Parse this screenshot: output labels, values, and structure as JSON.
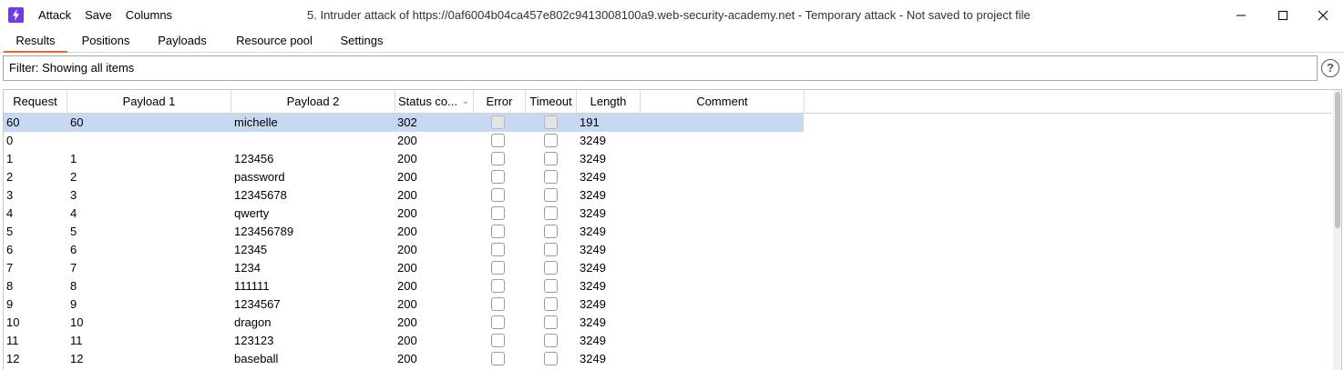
{
  "menu": [
    "Attack",
    "Save",
    "Columns"
  ],
  "window_title": "5. Intruder attack of https://0af6004b04ca457e802c9413008100a9.web-security-academy.net - Temporary attack - Not saved to project file",
  "tabs": [
    "Results",
    "Positions",
    "Payloads",
    "Resource pool",
    "Settings"
  ],
  "filter_text": "Filter: Showing all items",
  "help_label": "?",
  "columns": [
    "Request",
    "Payload 1",
    "Payload 2",
    "Status co...",
    "Error",
    "Timeout",
    "Length",
    "Comment"
  ],
  "colors": {
    "accent": "#e8672f",
    "selected_row": "#c7d9f2",
    "app_icon": "#6a3ee0"
  },
  "rows": [
    {
      "request": "60",
      "payload1": "60",
      "payload2": "michelle",
      "status": "302",
      "length": "191",
      "comment": "",
      "selected": true
    },
    {
      "request": "0",
      "payload1": "",
      "payload2": "",
      "status": "200",
      "length": "3249",
      "comment": ""
    },
    {
      "request": "1",
      "payload1": "1",
      "payload2": "123456",
      "status": "200",
      "length": "3249",
      "comment": ""
    },
    {
      "request": "2",
      "payload1": "2",
      "payload2": "password",
      "status": "200",
      "length": "3249",
      "comment": ""
    },
    {
      "request": "3",
      "payload1": "3",
      "payload2": "12345678",
      "status": "200",
      "length": "3249",
      "comment": ""
    },
    {
      "request": "4",
      "payload1": "4",
      "payload2": "qwerty",
      "status": "200",
      "length": "3249",
      "comment": ""
    },
    {
      "request": "5",
      "payload1": "5",
      "payload2": "123456789",
      "status": "200",
      "length": "3249",
      "comment": ""
    },
    {
      "request": "6",
      "payload1": "6",
      "payload2": "12345",
      "status": "200",
      "length": "3249",
      "comment": ""
    },
    {
      "request": "7",
      "payload1": "7",
      "payload2": "1234",
      "status": "200",
      "length": "3249",
      "comment": ""
    },
    {
      "request": "8",
      "payload1": "8",
      "payload2": "111111",
      "status": "200",
      "length": "3249",
      "comment": ""
    },
    {
      "request": "9",
      "payload1": "9",
      "payload2": "1234567",
      "status": "200",
      "length": "3249",
      "comment": ""
    },
    {
      "request": "10",
      "payload1": "10",
      "payload2": "dragon",
      "status": "200",
      "length": "3249",
      "comment": ""
    },
    {
      "request": "11",
      "payload1": "11",
      "payload2": "123123",
      "status": "200",
      "length": "3249",
      "comment": ""
    },
    {
      "request": "12",
      "payload1": "12",
      "payload2": "baseball",
      "status": "200",
      "length": "3249",
      "comment": ""
    }
  ]
}
